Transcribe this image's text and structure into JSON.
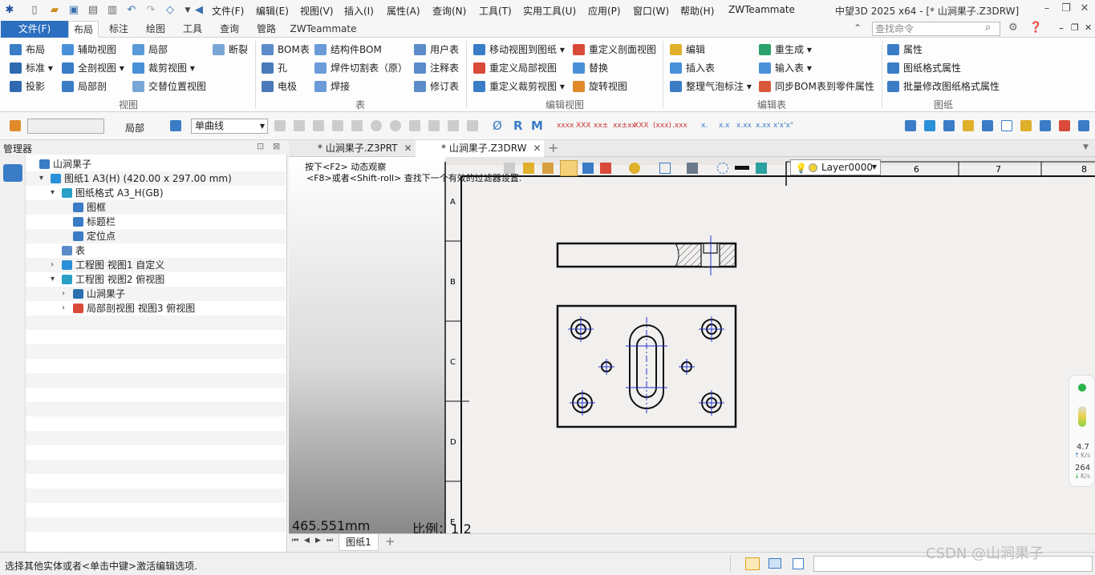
{
  "titlebar": {
    "menus": [
      "文件(F)",
      "编辑(E)",
      "视图(V)",
      "插入(I)",
      "属性(A)",
      "查询(N)",
      "工具(T)",
      "实用工具(U)",
      "应用(P)",
      "窗口(W)",
      "帮助(H)",
      "ZWTeammate"
    ],
    "window_title": "中望3D 2025 x64 - [* 山涧果子.Z3DRW]"
  },
  "ribbon_tabs": {
    "file": "文件(F)",
    "tabs": [
      "布局",
      "标注",
      "绘图",
      "工具",
      "查询",
      "管路",
      "ZWTeammate"
    ],
    "search_placeholder": "查找命令"
  },
  "ribbon": {
    "view_group": {
      "label": "视图",
      "buttons": [
        "布局",
        "辅助视图",
        "局部",
        "断裂",
        "标准",
        "全剖视图",
        "裁剪视图",
        "投影",
        "局部剖",
        "交替位置视图"
      ]
    },
    "table_group": {
      "label": "表",
      "buttons": [
        "BOM表",
        "结构件BOM",
        "用户表",
        "孔",
        "焊件切割表（原）",
        "注释表",
        "电极",
        "焊接",
        "修订表"
      ]
    },
    "edit_view_group": {
      "label": "编辑视图",
      "buttons": [
        "移动视图到图纸",
        "重定义剖面视图",
        "重定义局部视图",
        "替换",
        "重定义裁剪视图",
        "旋转视图"
      ]
    },
    "edit_table_group": {
      "label": "编辑表",
      "buttons": [
        "编辑",
        "重生成",
        "插入表",
        "输入表",
        "整理气泡标注",
        "同步BOM表到零件属性"
      ]
    },
    "sheet_group": {
      "label": "图纸",
      "buttons": [
        "属性",
        "图纸格式属性",
        "批量修改图纸格式属性"
      ]
    }
  },
  "toolrow": {
    "combo1": "",
    "local_label": "局部",
    "curve_combo": "单曲线"
  },
  "manager": {
    "title": "管理器",
    "tree": [
      {
        "label": "山涧果子",
        "indent": 0
      },
      {
        "label": "图纸1 A3(H) (420.00 x 297.00 mm)",
        "indent": 1
      },
      {
        "label": "图纸格式 A3_H(GB)",
        "indent": 2
      },
      {
        "label": "图框",
        "indent": 3
      },
      {
        "label": "标题栏",
        "indent": 3
      },
      {
        "label": "定位点",
        "indent": 3
      },
      {
        "label": "表",
        "indent": 2
      },
      {
        "label": "工程图 视图1 自定义",
        "indent": 2
      },
      {
        "label": "工程图 视图2 俯视图",
        "indent": 2
      },
      {
        "label": "山涧果子",
        "indent": 3
      },
      {
        "label": "局部剖视图 视图3 俯视图",
        "indent": 3
      }
    ]
  },
  "doc_tabs": [
    "* 山涧果子.Z3PRT",
    "* 山涧果子.Z3DRW"
  ],
  "canvas": {
    "hint1": "按下<F2> 动态观察",
    "hint2": "<F8>或者<Shift-roll> 查找下一个有效的过滤器设置.",
    "coord": "465.551mm",
    "scale": "比例：1:2",
    "layer": "Layer0000",
    "ruler_cols": [
      "6",
      "7",
      "8"
    ],
    "ruler_rows": [
      "A",
      "B",
      "C",
      "D",
      "E"
    ]
  },
  "sheet_tab": "图纸1",
  "status": {
    "text": "选择其他实体或者<单击中键>激活编辑选项.",
    "watermark": "CSDN @山涧果子"
  },
  "network": {
    "up_value": "4.7",
    "up_unit": "K/s",
    "down_value": "264",
    "down_unit": "K/s"
  },
  "colors": {
    "accent": "#2c6fc0",
    "centerline": "#2233cc",
    "drawing": "#111111"
  }
}
